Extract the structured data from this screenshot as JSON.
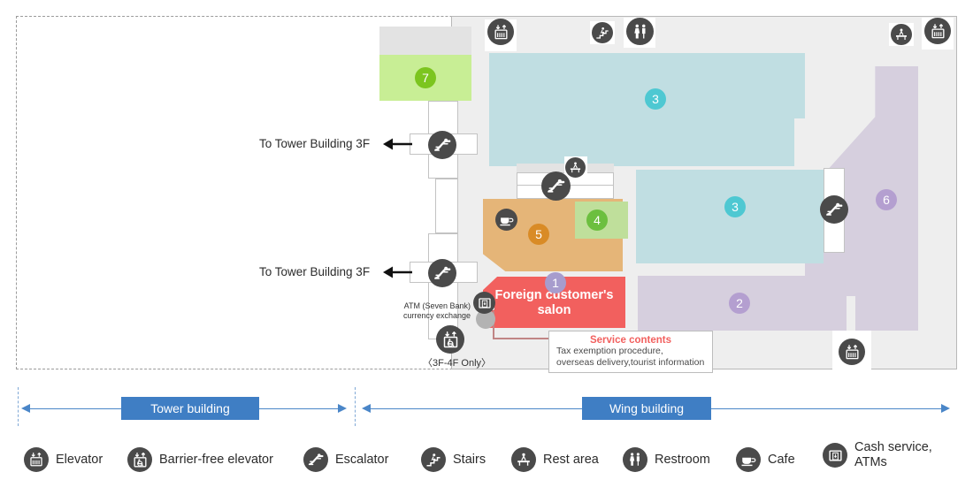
{
  "map": {
    "nav_labels": [
      {
        "text": "To Tower Building 3F"
      },
      {
        "text": "To Tower Building 3F"
      }
    ],
    "atm_label_line1": "ATM (Seven Bank)",
    "atm_label_line2": "currency exchange",
    "only_label": "〈3F-4F Only〉",
    "salon": {
      "title_line1": "Foreign customer's",
      "title_line2": "salon",
      "badge": "1",
      "color": "#f2605e"
    },
    "callout": {
      "title": "Service contents",
      "line1": "Tax exemption procedure,",
      "line2": "overseas delivery,tourist information"
    },
    "zones": [
      {
        "badge": "2",
        "color": "#d6cfde",
        "badge_color": "#b49fd0"
      },
      {
        "badge": "3",
        "color": "#c0dee2",
        "badge_color": "#4ec8d2"
      },
      {
        "badge": "3",
        "color": "#c0dee2",
        "badge_color": "#4ec8d2"
      },
      {
        "badge": "4",
        "color": "#bfdf9b",
        "badge_color": "#6cbf3f"
      },
      {
        "badge": "5",
        "color": "#e5b578",
        "badge_color": "#d98b26"
      },
      {
        "badge": "6",
        "color": "#d6cfde",
        "badge_color": "#b49fd0"
      },
      {
        "badge": "7",
        "color": "#c8ee95",
        "badge_color": "#7cc51f"
      }
    ],
    "icons": [
      {
        "name": "elevator-icon"
      },
      {
        "name": "stairs-icon"
      },
      {
        "name": "restroom-icon"
      },
      {
        "name": "rest-area-icon"
      },
      {
        "name": "elevator-icon"
      },
      {
        "name": "escalator-icon"
      },
      {
        "name": "escalator-icon"
      },
      {
        "name": "rest-area-icon"
      },
      {
        "name": "escalator-icon"
      },
      {
        "name": "cafe-icon"
      },
      {
        "name": "escalator-icon"
      },
      {
        "name": "atm-icon"
      },
      {
        "name": "barrier-free-elevator-icon"
      },
      {
        "name": "elevator-icon"
      }
    ]
  },
  "building_bar": {
    "tower_label": "Tower building",
    "wing_label": "Wing building",
    "accent_color": "#3f7ec4"
  },
  "legend": {
    "items": [
      {
        "icon": "elevator-icon",
        "label": "Elevator"
      },
      {
        "icon": "barrier-free-elevator-icon",
        "label": "Barrier-free elevator"
      },
      {
        "icon": "escalator-icon",
        "label": "Escalator"
      },
      {
        "icon": "stairs-icon",
        "label": "Stairs"
      },
      {
        "icon": "rest-area-icon",
        "label": "Rest area"
      },
      {
        "icon": "restroom-icon",
        "label": "Restroom"
      },
      {
        "icon": "cafe-icon",
        "label": "Cafe"
      },
      {
        "icon": "atm-icon",
        "label": "Cash service,\nATMs"
      }
    ]
  }
}
